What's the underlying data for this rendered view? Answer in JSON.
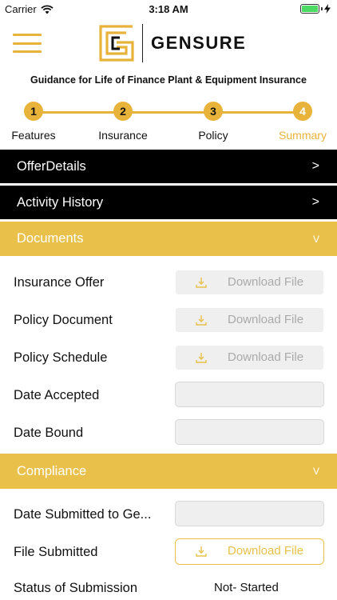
{
  "status_bar": {
    "carrier": "Carrier",
    "time": "3:18 AM"
  },
  "header": {
    "brand": "GENSURE"
  },
  "subtitle": "Guidance for Life of Finance Plant & Equipment Insurance",
  "stepper": [
    {
      "number": "1",
      "label": "Features"
    },
    {
      "number": "2",
      "label": "Insurance"
    },
    {
      "number": "3",
      "label": "Policy"
    },
    {
      "number": "4",
      "label": "Summary"
    }
  ],
  "sections": {
    "offer_details": {
      "label": "OfferDetails",
      "chevron": ">"
    },
    "activity_history": {
      "label": "Activity History",
      "chevron": ">"
    },
    "documents": {
      "label": "Documents",
      "chevron": "V"
    },
    "compliance": {
      "label": "Compliance",
      "chevron": "V"
    }
  },
  "documents": {
    "insurance_offer": {
      "label": "Insurance Offer",
      "button": "Download File"
    },
    "policy_document": {
      "label": "Policy Document",
      "button": "Download File"
    },
    "policy_schedule": {
      "label": "Policy Schedule",
      "button": "Download File"
    },
    "date_accepted": {
      "label": "Date Accepted",
      "value": ""
    },
    "date_bound": {
      "label": "Date Bound",
      "value": ""
    }
  },
  "compliance": {
    "date_submitted": {
      "label": "Date Submitted to Ge...",
      "value": ""
    },
    "file_submitted": {
      "label": "File Submitted",
      "button": "Download File"
    },
    "status": {
      "label": "Status of Submission",
      "value": "Not- Started"
    }
  },
  "colors": {
    "accent": "#e8b33a",
    "section_gold": "#e8c04a",
    "section_black": "#000000"
  }
}
